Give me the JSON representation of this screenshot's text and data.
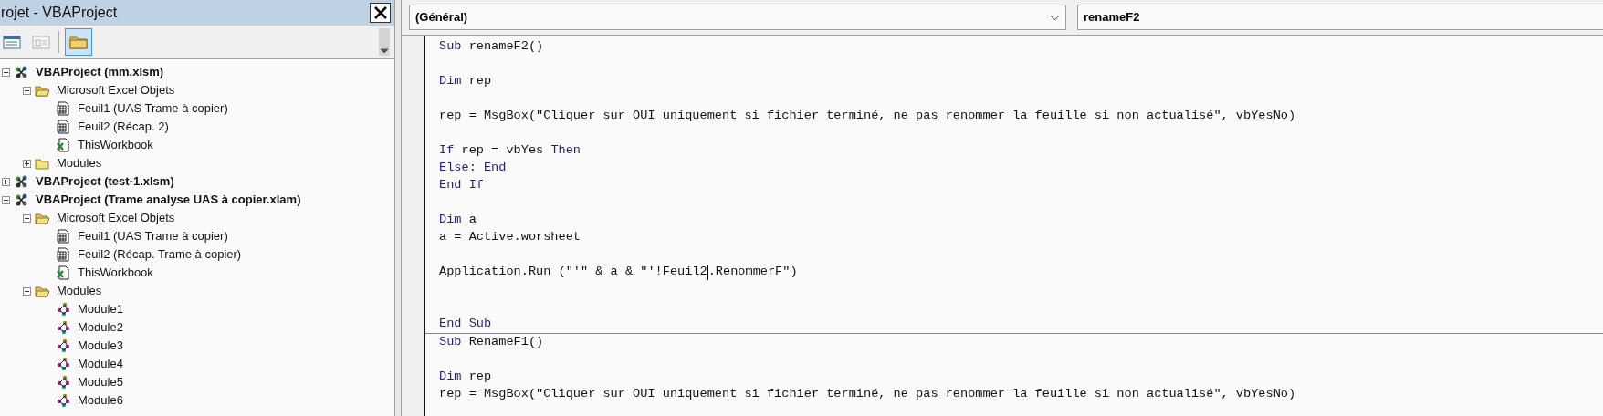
{
  "project_explorer": {
    "title": "rojet - VBAProject",
    "toolbar": [
      {
        "kind": "view-code",
        "disabled": false,
        "pressed": false
      },
      {
        "kind": "view-object",
        "disabled": true,
        "pressed": false
      },
      {
        "kind": "toggle-folders",
        "disabled": false,
        "pressed": true
      }
    ],
    "tree": [
      {
        "label": "VBAProject (mm.xlsm)",
        "kind": "project",
        "expanded": true,
        "children": [
          {
            "label": "Microsoft Excel Objets",
            "kind": "folder",
            "expanded": true,
            "children": [
              {
                "label": "Feuil1 (UAS Trame à copier)",
                "kind": "sheet"
              },
              {
                "label": "Feuil2 (Récap. 2)",
                "kind": "sheet"
              },
              {
                "label": "ThisWorkbook",
                "kind": "workbook"
              }
            ]
          },
          {
            "label": "Modules",
            "kind": "folder",
            "expanded": false
          }
        ]
      },
      {
        "label": "VBAProject (test-1.xlsm)",
        "kind": "project",
        "expanded": false
      },
      {
        "label": "VBAProject (Trame analyse UAS à copier.xlam)",
        "kind": "project",
        "expanded": true,
        "children": [
          {
            "label": "Microsoft Excel Objets",
            "kind": "folder",
            "expanded": true,
            "children": [
              {
                "label": "Feuil1 (UAS Trame à copier)",
                "kind": "sheet"
              },
              {
                "label": "Feuil2 (Récap. Trame à copier)",
                "kind": "sheet"
              },
              {
                "label": "ThisWorkbook",
                "kind": "workbook"
              }
            ]
          },
          {
            "label": "Modules",
            "kind": "folder",
            "expanded": true,
            "children": [
              {
                "label": "Module1",
                "kind": "module"
              },
              {
                "label": "Module2",
                "kind": "module"
              },
              {
                "label": "Module3",
                "kind": "module"
              },
              {
                "label": "Module4",
                "kind": "module"
              },
              {
                "label": "Module5",
                "kind": "module"
              },
              {
                "label": "Module6",
                "kind": "module"
              }
            ]
          }
        ]
      }
    ]
  },
  "code_window": {
    "object_dropdown": "(Général)",
    "procedure_dropdown": "renameF2",
    "procedures": [
      {
        "lines": [
          {
            "kind": "code",
            "segments": [
              {
                "kind": "keyword",
                "text": "Sub"
              },
              {
                "kind": "plain",
                "text": " renameF2()"
              }
            ]
          },
          {
            "kind": "blank"
          },
          {
            "kind": "code",
            "segments": [
              {
                "kind": "keyword",
                "text": "Dim"
              },
              {
                "kind": "plain",
                "text": " rep"
              }
            ]
          },
          {
            "kind": "blank"
          },
          {
            "kind": "code",
            "segments": [
              {
                "kind": "plain",
                "text": "rep = MsgBox(\"Cliquer sur OUI uniquement si fichier terminé, ne pas renommer la feuille si non actualisé\", vbYesNo)"
              }
            ]
          },
          {
            "kind": "blank"
          },
          {
            "kind": "code",
            "segments": [
              {
                "kind": "keyword",
                "text": "If"
              },
              {
                "kind": "plain",
                "text": " rep = vbYes "
              },
              {
                "kind": "keyword",
                "text": "Then"
              }
            ]
          },
          {
            "kind": "code",
            "segments": [
              {
                "kind": "keyword",
                "text": "Else: End"
              }
            ]
          },
          {
            "kind": "code",
            "segments": [
              {
                "kind": "keyword",
                "text": "End If"
              }
            ]
          },
          {
            "kind": "blank"
          },
          {
            "kind": "code",
            "segments": [
              {
                "kind": "keyword",
                "text": "Dim"
              },
              {
                "kind": "plain",
                "text": " a"
              }
            ]
          },
          {
            "kind": "code",
            "segments": [
              {
                "kind": "plain",
                "text": "a = Active.worsheet"
              }
            ]
          },
          {
            "kind": "blank"
          },
          {
            "kind": "code",
            "segments": [
              {
                "kind": "plain",
                "text": "Application.Run (\"'\" & a & \"'!Feuil2"
              },
              {
                "kind": "caret"
              },
              {
                "kind": "plain",
                "text": ".RenommerF\")"
              }
            ]
          },
          {
            "kind": "blank"
          },
          {
            "kind": "blank"
          },
          {
            "kind": "code",
            "segments": [
              {
                "kind": "keyword",
                "text": "End Sub"
              }
            ]
          }
        ]
      },
      {
        "lines": [
          {
            "kind": "code",
            "segments": [
              {
                "kind": "keyword",
                "text": "Sub"
              },
              {
                "kind": "plain",
                "text": " RenameF1()"
              }
            ]
          },
          {
            "kind": "blank"
          },
          {
            "kind": "code",
            "segments": [
              {
                "kind": "keyword",
                "text": "Dim"
              },
              {
                "kind": "plain",
                "text": " rep"
              }
            ]
          },
          {
            "kind": "code",
            "segments": [
              {
                "kind": "plain",
                "text": "rep = MsgBox(\"Cliquer sur OUI uniquement si fichier terminé, ne pas renommer la feuille si non actualisé\", vbYesNo)"
              }
            ]
          }
        ]
      }
    ]
  }
}
